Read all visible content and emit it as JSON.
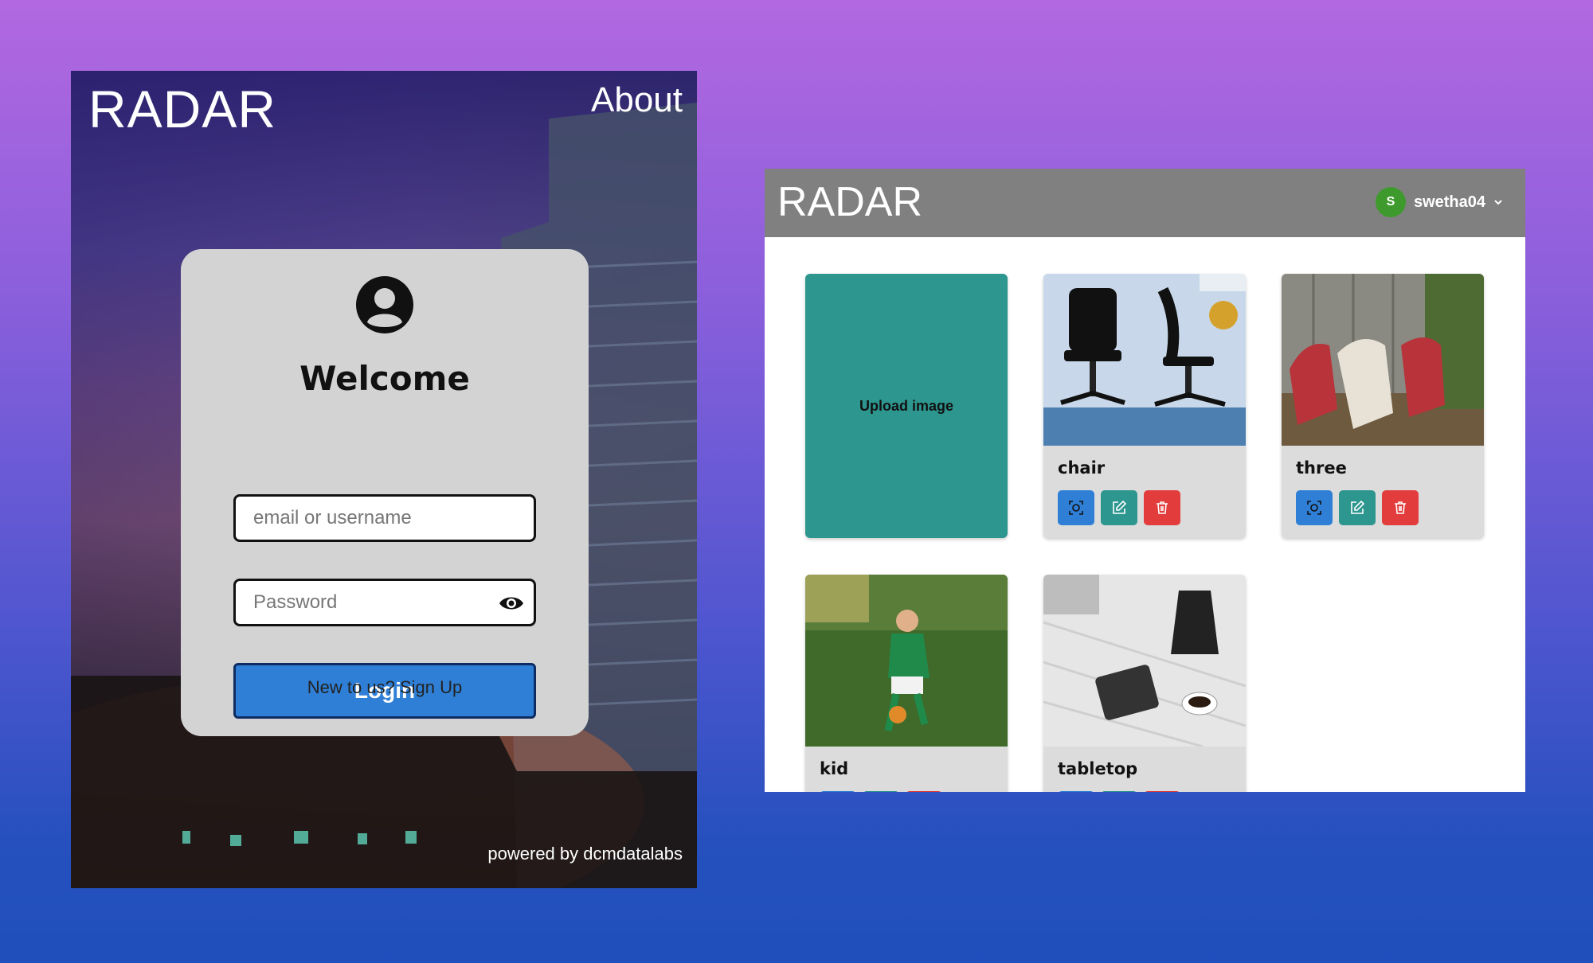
{
  "login": {
    "brand": "RADAR",
    "about_label": "About",
    "welcome": "Welcome",
    "email_placeholder": "email or username",
    "password_placeholder": "Password",
    "login_label": "Login",
    "signup_text": "New to us? Sign Up",
    "powered_by": "powered by dcmdatalabs",
    "icons": {
      "avatar": "user-circle-icon",
      "toggle_password": "eye-icon"
    },
    "colors": {
      "card": "#d3d3d3",
      "login_button": "#2f7fd6"
    }
  },
  "gallery": {
    "brand": "RADAR",
    "user": {
      "initial": "S",
      "name": "swetha04",
      "avatar_color": "#3e9a2c"
    },
    "upload_label": "Upload image",
    "cards": [
      {
        "title": "chair",
        "thumbnail": "chair"
      },
      {
        "title": "three",
        "thumbnail": "chairs"
      },
      {
        "title": "kid",
        "thumbnail": "soccer-kid"
      },
      {
        "title": "tabletop",
        "thumbnail": "tabletop"
      }
    ],
    "actions": [
      "detect-icon",
      "edit-icon",
      "trash-icon"
    ],
    "colors": {
      "header": "#808080",
      "upload_card": "#2d968f",
      "detect": "#2f7fd6",
      "edit": "#2d968f",
      "delete": "#e23c3c"
    }
  }
}
